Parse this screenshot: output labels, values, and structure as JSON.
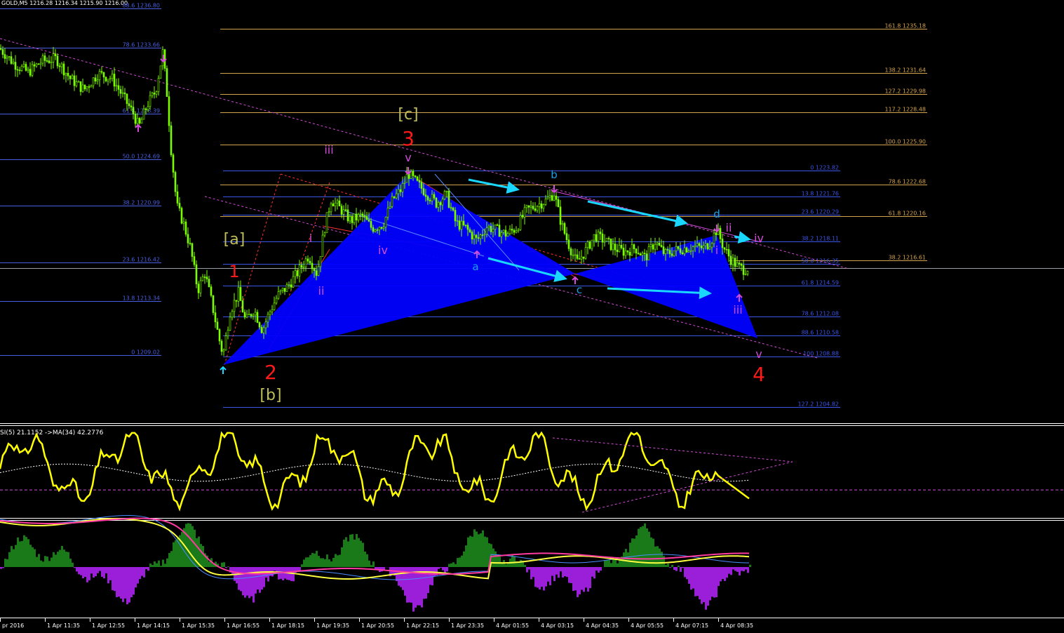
{
  "header": {
    "symbol_readout": "GOLD,M5 1216.28 1216.34 1215.90 1216.00"
  },
  "colors": {
    "background": "#000000",
    "candle": "#7cfc00",
    "fib_left": "#4a5fe0",
    "fib_orange": "#d2a24c",
    "fib_right_blue": "#3b55e6",
    "pattern_fill": "#0000ff",
    "cyan_arrow": "#19d7ff",
    "magenta": "#d24bd8",
    "red": "#ff1a1a",
    "olive": "#bdbd5a",
    "rsi": "#ffff00",
    "macd_up": "#1a7a1a",
    "macd_down": "#9b1fd8",
    "signal_pink": "#ff3aa0",
    "signal_yellow": "#ffff40",
    "signal_blue": "#4a8cff"
  },
  "chart_data": {
    "type": "candlestick",
    "title": "GOLD,M5 1216.28 1216.34 1215.90 1216.00",
    "price_range": [
      1203.6,
      1237.5
    ],
    "close_path": [
      [
        0,
        1233.6
      ],
      [
        20,
        1232.4
      ],
      [
        40,
        1231.7
      ],
      [
        60,
        1232.6
      ],
      [
        80,
        1232.8
      ],
      [
        100,
        1231.2
      ],
      [
        120,
        1230.3
      ],
      [
        140,
        1231.6
      ],
      [
        160,
        1231.2
      ],
      [
        175,
        1229.8
      ],
      [
        190,
        1228.4
      ],
      [
        198,
        1227.3
      ],
      [
        210,
        1229.1
      ],
      [
        222,
        1230.2
      ],
      [
        232,
        1233.3
      ],
      [
        238,
        1230.0
      ],
      [
        244,
        1225.5
      ],
      [
        252,
        1221.0
      ],
      [
        262,
        1219.5
      ],
      [
        272,
        1217.5
      ],
      [
        282,
        1214.2
      ],
      [
        292,
        1215.6
      ],
      [
        302,
        1213.2
      ],
      [
        312,
        1210.4
      ],
      [
        318,
        1209.0
      ],
      [
        328,
        1212.5
      ],
      [
        340,
        1214.0
      ],
      [
        350,
        1211.7
      ],
      [
        362,
        1212.7
      ],
      [
        374,
        1211.0
      ],
      [
        384,
        1212.4
      ],
      [
        396,
        1213.8
      ],
      [
        410,
        1214.5
      ],
      [
        424,
        1215.6
      ],
      [
        440,
        1217.0
      ],
      [
        452,
        1215.5
      ],
      [
        462,
        1219.0
      ],
      [
        472,
        1221.5
      ],
      [
        486,
        1220.7
      ],
      [
        500,
        1219.8
      ],
      [
        516,
        1220.2
      ],
      [
        530,
        1219.2
      ],
      [
        546,
        1219.5
      ],
      [
        560,
        1221.5
      ],
      [
        572,
        1222.3
      ],
      [
        582,
        1223.6
      ],
      [
        594,
        1222.8
      ],
      [
        608,
        1222.0
      ],
      [
        622,
        1221.2
      ],
      [
        636,
        1221.9
      ],
      [
        650,
        1219.6
      ],
      [
        664,
        1219.2
      ],
      [
        680,
        1218.2
      ],
      [
        694,
        1219.3
      ],
      [
        710,
        1219.0
      ],
      [
        722,
        1218.7
      ],
      [
        736,
        1219.2
      ],
      [
        750,
        1220.6
      ],
      [
        764,
        1221.0
      ],
      [
        778,
        1221.4
      ],
      [
        790,
        1222.0
      ],
      [
        800,
        1219.6
      ],
      [
        810,
        1218.0
      ],
      [
        822,
        1216.4
      ],
      [
        834,
        1217.3
      ],
      [
        848,
        1218.6
      ],
      [
        862,
        1218.2
      ],
      [
        876,
        1217.6
      ],
      [
        890,
        1217.3
      ],
      [
        906,
        1217.6
      ],
      [
        920,
        1216.8
      ],
      [
        934,
        1218.1
      ],
      [
        948,
        1217.1
      ],
      [
        962,
        1217.4
      ],
      [
        976,
        1217.6
      ],
      [
        990,
        1217.7
      ],
      [
        1004,
        1217.6
      ],
      [
        1014,
        1218.2
      ],
      [
        1022,
        1219.1
      ],
      [
        1032,
        1217.6
      ],
      [
        1042,
        1216.7
      ],
      [
        1052,
        1216.1
      ],
      [
        1060,
        1215.9
      ],
      [
        1068,
        1216.0
      ]
    ],
    "fib_levels_left": [
      {
        "label": "88.6 1236.80",
        "price": 1236.8
      },
      {
        "label": "78.6 1233.66",
        "price": 1233.66
      },
      {
        "label": "61.8 1228.39",
        "price": 1228.39
      },
      {
        "label": "50.0 1224.69",
        "price": 1224.69
      },
      {
        "label": "38.2 1220.99",
        "price": 1220.99
      },
      {
        "label": "23.6 1216.42",
        "price": 1216.42
      },
      {
        "label": "13.8 1213.34",
        "price": 1213.34
      },
      {
        "label": "0 1209.02",
        "price": 1209.02
      }
    ],
    "fib_levels_orange": [
      {
        "label": "161.8 1235.18",
        "price": 1235.18
      },
      {
        "label": "138.2 1231.64",
        "price": 1231.64
      },
      {
        "label": "127.2 1229.98",
        "price": 1229.98
      },
      {
        "label": "117.2 1228.48",
        "price": 1228.48
      },
      {
        "label": "100.0  1225.90",
        "price": 1225.9
      },
      {
        "label": "78.6 1222.68",
        "price": 1222.68
      },
      {
        "label": "61.8 1220.16",
        "price": 1220.16
      },
      {
        "label": "38.2 1216.61",
        "price": 1216.61
      }
    ],
    "fib_levels_right": [
      {
        "label": "0 1223.82",
        "price": 1223.82
      },
      {
        "label": "13.8 1221.76",
        "price": 1221.76
      },
      {
        "label": "23.6 1220.29",
        "price": 1220.29
      },
      {
        "label": "38.2 1218.11",
        "price": 1218.11
      },
      {
        "label": "50.0 1216.35",
        "price": 1216.35
      },
      {
        "label": "61.8 1214.59",
        "price": 1214.59
      },
      {
        "label": "78.6 1212.08",
        "price": 1212.08
      },
      {
        "label": "88.6 1210.58",
        "price": 1210.58
      },
      {
        "label": "100 1208.88",
        "price": 1208.88
      },
      {
        "label": "127.2 1204.82",
        "price": 1204.82
      }
    ],
    "wave_labels": [
      {
        "text": "[a]",
        "color": "olive",
        "size": 22
      },
      {
        "text": "1",
        "color": "red",
        "size": 24
      },
      {
        "text": "2",
        "color": "red",
        "size": 28
      },
      {
        "text": "[b]",
        "color": "olive",
        "size": 22
      },
      {
        "text": "i",
        "color": "magenta",
        "size": 16
      },
      {
        "text": "ii",
        "color": "magenta",
        "size": 16
      },
      {
        "text": "iii",
        "color": "magenta",
        "size": 16
      },
      {
        "text": "iv",
        "color": "magenta",
        "size": 16
      },
      {
        "text": "v",
        "color": "magenta",
        "size": 16
      },
      {
        "text": "3",
        "color": "red",
        "size": 28
      },
      {
        "text": "[c]",
        "color": "olive",
        "size": 22
      },
      {
        "text": "a",
        "color": "cyan",
        "size": 15
      },
      {
        "text": "b",
        "color": "cyan",
        "size": 15
      },
      {
        "text": "c",
        "color": "cyan",
        "size": 15
      },
      {
        "text": "d",
        "color": "cyan",
        "size": 15
      },
      {
        "text": "i",
        "color": "magenta",
        "size": 16
      },
      {
        "text": "ii",
        "color": "magenta",
        "size": 16
      },
      {
        "text": "iii",
        "color": "magenta",
        "size": 16
      },
      {
        "text": "iv",
        "color": "magenta",
        "size": 16
      },
      {
        "text": "v",
        "color": "magenta",
        "size": 16
      },
      {
        "text": "4",
        "color": "red",
        "size": 28
      }
    ],
    "rsi": {
      "label": "SI(5) 21.1152  ->MA(34) 42.2776",
      "value": 21.1152,
      "ma": 42.2776
    },
    "x_ticks": [
      "pr 2016",
      "1 Apr 11:35",
      "1 Apr 12:55",
      "1 Apr 14:15",
      "1 Apr 15:35",
      "1 Apr 16:55",
      "1 Apr 18:15",
      "1 Apr 19:35",
      "1 Apr 20:55",
      "1 Apr 22:15",
      "1 Apr 23:35",
      "4 Apr 01:55",
      "4 Apr 03:15",
      "4 Apr 04:35",
      "4 Apr 05:55",
      "4 Apr 07:15",
      "4 Apr 08:35"
    ]
  }
}
